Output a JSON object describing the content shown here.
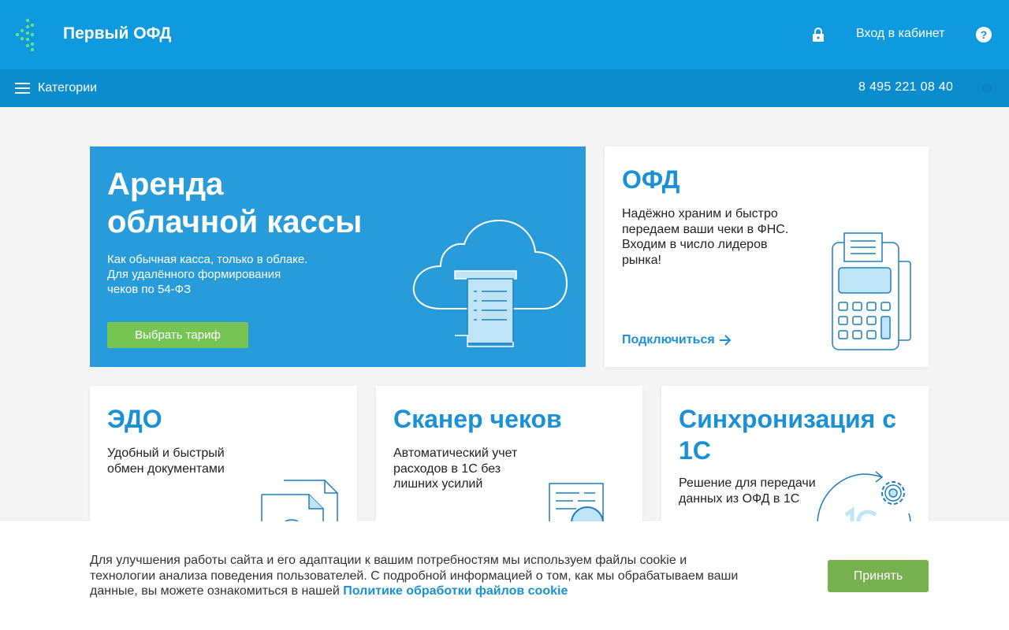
{
  "colors": {
    "header_bg": "#0f9ae0",
    "category_bar_bg": "#0b8ccc",
    "accent": "#1a90d6",
    "button_green": "#76c454",
    "page_bg": "#f4f4f4"
  },
  "header": {
    "logo_icon": "dots-logo-icon",
    "logo_text": "Первый ОФД",
    "lock_icon": "lock-icon",
    "login_label": "Вход в кабинет",
    "help_icon": "question-circle-icon"
  },
  "category_bar": {
    "menu_icon": "hamburger-menu-icon",
    "label": "Категории",
    "phone": "8 495 221 08 40"
  },
  "cards": {
    "rent": {
      "title_line1": "Аренда",
      "title_line2": "облачной кассы",
      "desc_line1": "Как обычная касса, только в облаке.",
      "desc_line2": "Для удалённого формирования",
      "desc_line3": "чеков по 54-ФЗ",
      "button": "Выбрать тариф",
      "illustration": "cloud-receipt-icon"
    },
    "ofd": {
      "title": "ОФД",
      "desc_line1": "Надёжно храним и быстро",
      "desc_line2": "передаем ваши чеки в ФНС.",
      "desc_line3": "Входим в число лидеров",
      "desc_line4": "рынка!",
      "link": "Подключиться",
      "illustration": "payment-terminal-icon"
    },
    "edo": {
      "title": "ЭДО",
      "desc_line1": "Удобный и быстрый",
      "desc_line2": "обмен документами",
      "illustration": "documents-icon"
    },
    "scanner": {
      "title": "Сканер чеков",
      "desc_line1": "Автоматический учет",
      "desc_line2": "расходов в 1С без",
      "desc_line3": "лишних усилий",
      "illustration": "receipt-scan-icon"
    },
    "sync": {
      "title_line1": "Синхронизация с",
      "title_line2": "1С",
      "desc_line1": "Решение для передачи",
      "desc_line2": "данных из ОФД в 1С",
      "illustration": "sync-1c-gear-icon"
    }
  },
  "cookie": {
    "text_line1": "Для улучшения работы сайта и его адаптации к вашим потребностям мы используем файлы cookie и",
    "text_line2": "технологии анализа поведения пользователей. С подробной информацией о том, как мы обрабатываем ваши",
    "text_line3": "данные, вы можете ознакомиться в нашей ",
    "link": "Политике обработки файлов cookie",
    "accept": "Принять"
  }
}
